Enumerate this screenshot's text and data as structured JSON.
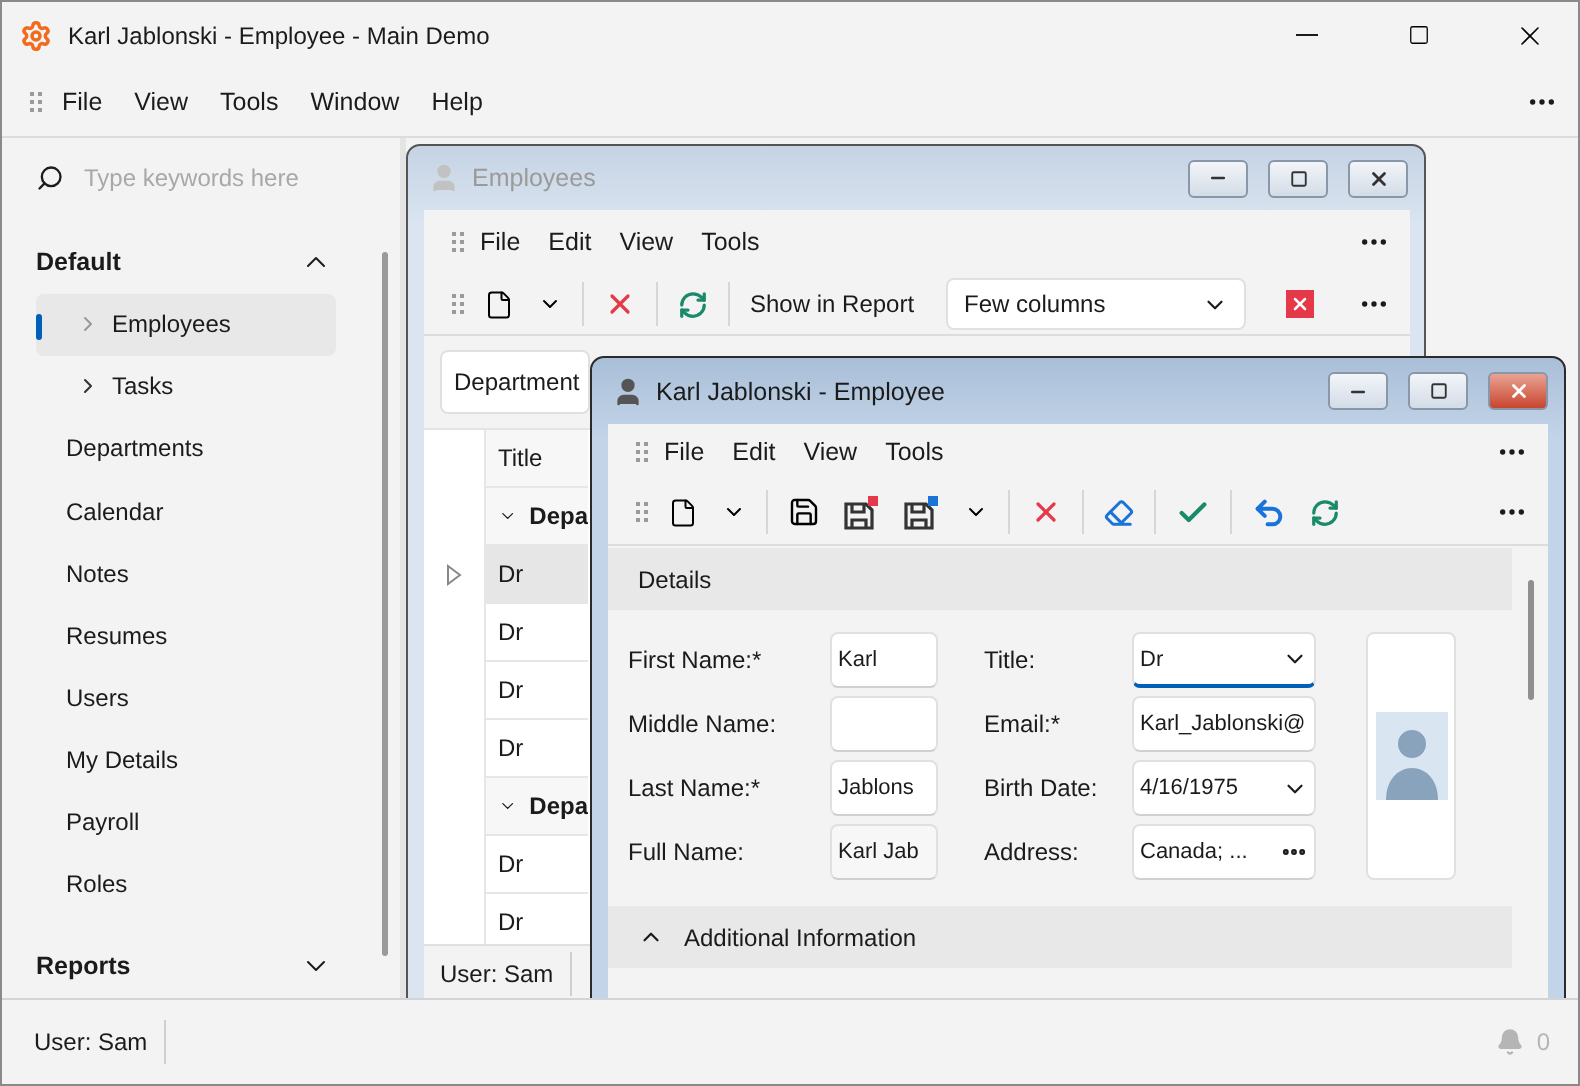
{
  "window": {
    "title": "Karl Jablonski - Employee - Main Demo"
  },
  "menu": [
    "File",
    "View",
    "Tools",
    "Window",
    "Help"
  ],
  "sidebar": {
    "search": {
      "placeholder": "Type keywords here"
    },
    "groups": [
      {
        "label": "Default",
        "expanded": true,
        "items": [
          {
            "label": "Employees",
            "kind": "folder",
            "selected": true
          },
          {
            "label": "Tasks",
            "kind": "folder",
            "selected": false
          },
          {
            "label": "Departments",
            "kind": "link",
            "selected": false
          },
          {
            "label": "Calendar",
            "kind": "link",
            "selected": false
          },
          {
            "label": "Notes",
            "kind": "link",
            "selected": false
          },
          {
            "label": "Resumes",
            "kind": "link",
            "selected": false
          },
          {
            "label": "Users",
            "kind": "link",
            "selected": false
          },
          {
            "label": "My Details",
            "kind": "link",
            "selected": false
          },
          {
            "label": "Payroll",
            "kind": "link",
            "selected": false
          },
          {
            "label": "Roles",
            "kind": "link",
            "selected": false
          }
        ]
      },
      {
        "label": "Reports",
        "expanded": false
      }
    ]
  },
  "employees_window": {
    "title": "Employees",
    "active": false,
    "menu": [
      "File",
      "Edit",
      "View",
      "Tools"
    ],
    "toolbar": {
      "report_label": "Show in Report",
      "report_choice": "Few columns"
    },
    "group_panel": [
      "Department"
    ],
    "grid": {
      "columns": [
        "Title"
      ],
      "rows": [
        {
          "kind": "group",
          "text": "Depa",
          "expanded": true
        },
        {
          "kind": "data",
          "text": "Dr",
          "selected": true
        },
        {
          "kind": "data",
          "text": "Dr",
          "selected": false
        },
        {
          "kind": "data",
          "text": "Dr",
          "selected": false
        },
        {
          "kind": "data",
          "text": "Dr",
          "selected": false
        },
        {
          "kind": "group",
          "text": "Depa",
          "expanded": true
        },
        {
          "kind": "data",
          "text": "Dr",
          "selected": false
        },
        {
          "kind": "data",
          "text": "Dr",
          "selected": false
        }
      ]
    },
    "status": "User: Sam"
  },
  "employee_window": {
    "title": "Karl Jablonski - Employee",
    "active": true,
    "menu": [
      "File",
      "Edit",
      "View",
      "Tools"
    ],
    "details": {
      "title": "Details",
      "fields": [
        {
          "label": "First Name:*",
          "value": "Karl",
          "kind": "text",
          "focused": false
        },
        {
          "label": "Title:",
          "value": "Dr",
          "kind": "dropdown",
          "focused": true
        },
        {
          "label": "Middle Name:",
          "kind": "text",
          "focused": false
        },
        {
          "label": "Email:*",
          "value": "Karl_Jablonski@",
          "kind": "text",
          "focused": false
        },
        {
          "label": "Last Name:*",
          "value": "Jablons",
          "kind": "text",
          "focused": false
        },
        {
          "label": "Birth Date:",
          "value": "4/16/1975",
          "kind": "dropdown",
          "focused": false
        },
        {
          "label": "Full Name:",
          "value": "Karl Jab",
          "kind": "readonly",
          "focused": false
        },
        {
          "label": "Address:",
          "value": "Canada; ...",
          "kind": "button",
          "focused": false
        }
      ]
    },
    "additional": {
      "title": "Additional Information",
      "expanded": true
    }
  },
  "status_bar": {
    "user": "User: Sam",
    "notifications": "0"
  }
}
